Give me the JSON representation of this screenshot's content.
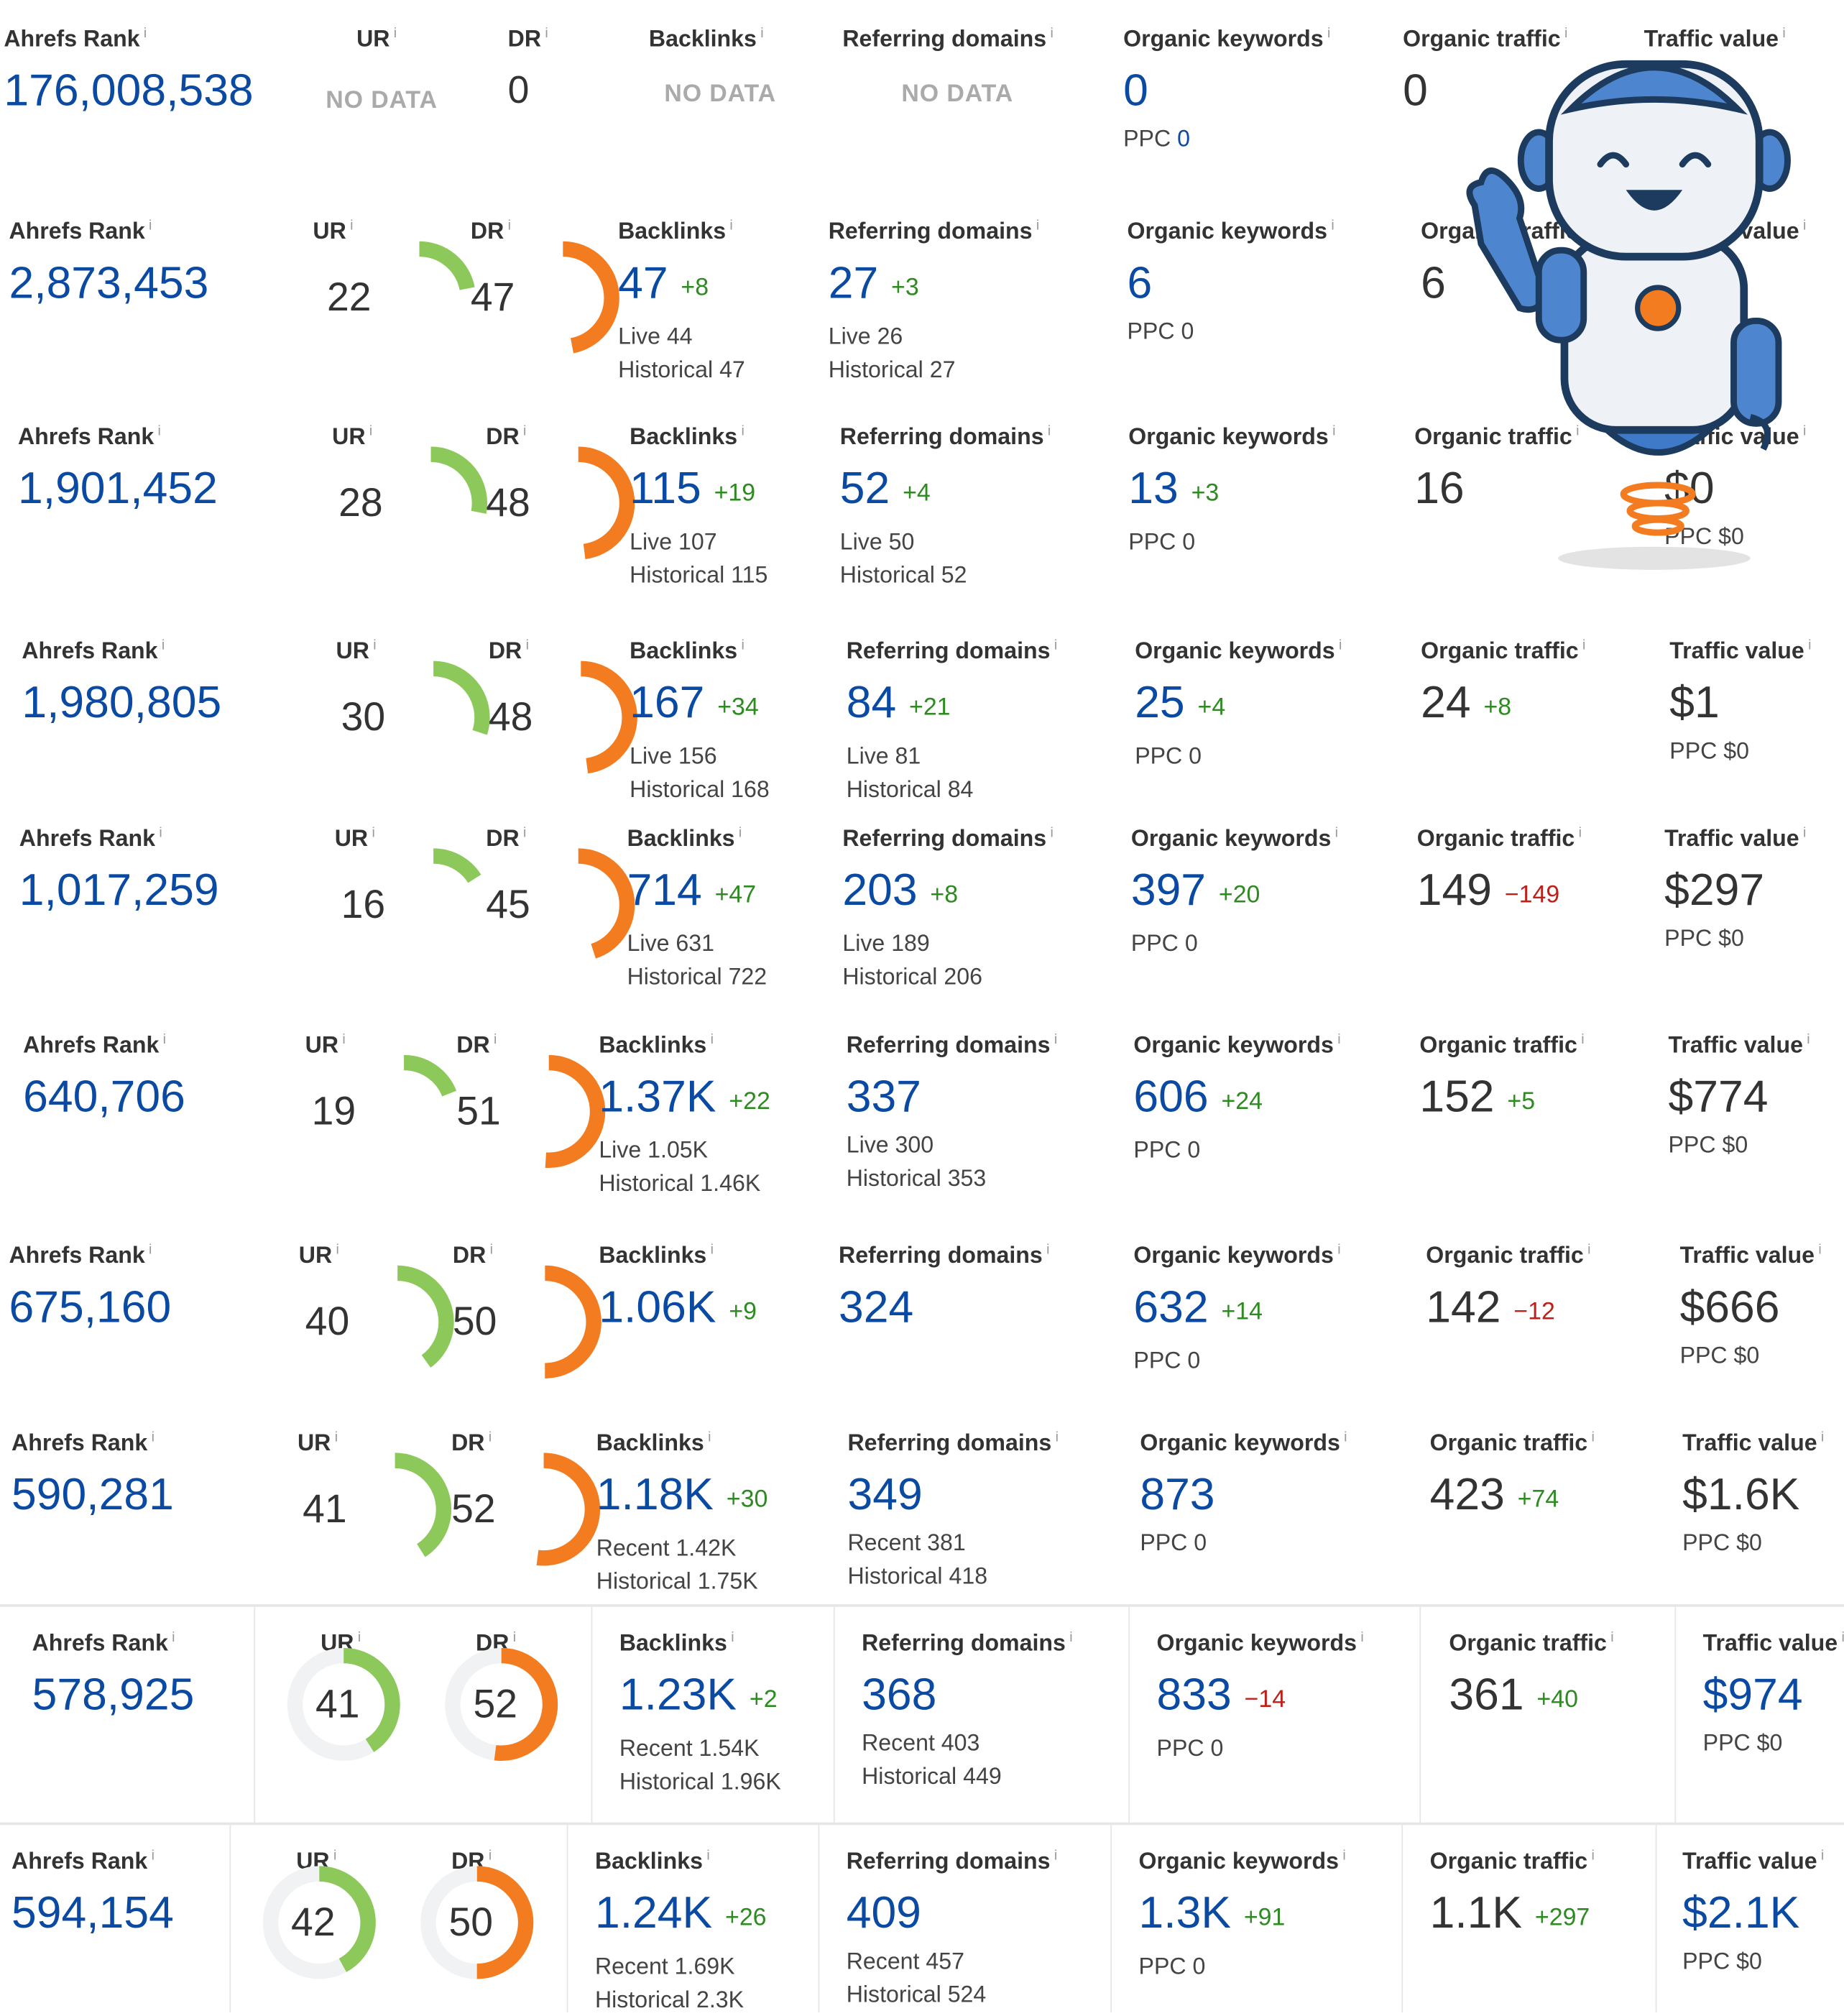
{
  "labels": {
    "ahrefs_rank": "Ahrefs Rank",
    "ur": "UR",
    "dr": "DR",
    "backlinks": "Backlinks",
    "referring_domains": "Referring domains",
    "organic_keywords": "Organic keywords",
    "organic_traffic": "Organic traffic",
    "traffic_value": "Traffic value",
    "info": "i",
    "no_data": "NO DATA",
    "live": "Live",
    "historical": "Historical",
    "recent": "Recent",
    "ppc": "PPC"
  },
  "colors": {
    "ur_ring": "#8dc85a",
    "dr_ring": "#f47c20",
    "ring_track": "#f1f2f3",
    "accent_blue": "#0b4aa2"
  },
  "rows": [
    {
      "rank": "176,008,538",
      "ur": "NO DATA",
      "dr": "0",
      "backlinks": "NO DATA",
      "refdomains": "NO DATA",
      "keywords": "0",
      "keywords_ppc": "0",
      "traffic": "0"
    },
    {
      "rank": "2,873,453",
      "ur": "22",
      "dr": "47",
      "backlinks": "47",
      "backlinks_delta": "+8",
      "backlinks_live": "44",
      "backlinks_hist": "47",
      "refdomains": "27",
      "refdomains_delta": "+3",
      "refdomains_live": "26",
      "refdomains_hist": "27",
      "keywords": "6",
      "keywords_ppc": "0",
      "traffic": "6"
    },
    {
      "rank": "1,901,452",
      "ur": "28",
      "dr": "48",
      "backlinks": "115",
      "backlinks_delta": "+19",
      "backlinks_live": "107",
      "backlinks_hist": "115",
      "refdomains": "52",
      "refdomains_delta": "+4",
      "refdomains_live": "50",
      "refdomains_hist": "52",
      "keywords": "13",
      "keywords_delta": "+3",
      "keywords_ppc": "0",
      "traffic": "16",
      "value": "$0",
      "value_ppc": "$0"
    },
    {
      "rank": "1,980,805",
      "ur": "30",
      "dr": "48",
      "backlinks": "167",
      "backlinks_delta": "+34",
      "backlinks_live": "156",
      "backlinks_hist": "168",
      "refdomains": "84",
      "refdomains_delta": "+21",
      "refdomains_live": "81",
      "refdomains_hist": "84",
      "keywords": "25",
      "keywords_delta": "+4",
      "keywords_ppc": "0",
      "traffic": "24",
      "traffic_delta": "+8",
      "value": "$1",
      "value_ppc": "$0"
    },
    {
      "rank": "1,017,259",
      "ur": "16",
      "dr": "45",
      "backlinks": "714",
      "backlinks_delta": "+47",
      "backlinks_live": "631",
      "backlinks_hist": "722",
      "refdomains": "203",
      "refdomains_delta": "+8",
      "refdomains_live": "189",
      "refdomains_hist": "206",
      "keywords": "397",
      "keywords_delta": "+20",
      "keywords_ppc": "0",
      "traffic": "149",
      "traffic_delta": "−149",
      "value": "$297",
      "value_ppc": "$0"
    },
    {
      "rank": "640,706",
      "ur": "19",
      "dr": "51",
      "backlinks": "1.37K",
      "backlinks_delta": "+22",
      "backlinks_live": "1.05K",
      "backlinks_hist": "1.46K",
      "refdomains": "337",
      "refdomains_live": "300",
      "refdomains_hist": "353",
      "keywords": "606",
      "keywords_delta": "+24",
      "keywords_ppc": "0",
      "traffic": "152",
      "traffic_delta": "+5",
      "value": "$774",
      "value_ppc": "$0"
    },
    {
      "rank": "675,160",
      "ur": "40",
      "dr": "50",
      "backlinks": "1.06K",
      "backlinks_delta": "+9",
      "refdomains": "324",
      "keywords": "632",
      "keywords_delta": "+14",
      "keywords_ppc": "0",
      "traffic": "142",
      "traffic_delta": "−12",
      "value": "$666",
      "value_ppc": "$0"
    },
    {
      "rank": "590,281",
      "ur": "41",
      "dr": "52",
      "backlinks": "1.18K",
      "backlinks_delta": "+30",
      "backlinks_recent": "1.42K",
      "backlinks_hist": "1.75K",
      "refdomains": "349",
      "refdomains_recent": "381",
      "refdomains_hist": "418",
      "keywords": "873",
      "keywords_ppc": "0",
      "traffic": "423",
      "traffic_delta": "+74",
      "value": "$1.6K",
      "value_ppc": "$0"
    },
    {
      "rank": "578,925",
      "ur": "41",
      "dr": "52",
      "backlinks": "1.23K",
      "backlinks_delta": "+2",
      "backlinks_recent": "1.54K",
      "backlinks_hist": "1.96K",
      "refdomains": "368",
      "refdomains_recent": "403",
      "refdomains_hist": "449",
      "keywords": "833",
      "keywords_delta": "−14",
      "keywords_ppc": "0",
      "traffic": "361",
      "traffic_delta": "+40",
      "value": "$974",
      "value_ppc": "$0"
    },
    {
      "rank": "594,154",
      "ur": "42",
      "dr": "50",
      "backlinks": "1.24K",
      "backlinks_delta": "+26",
      "backlinks_recent": "1.69K",
      "backlinks_hist": "2.3K",
      "refdomains": "409",
      "refdomains_recent": "457",
      "refdomains_hist": "524",
      "keywords": "1.3K",
      "keywords_delta": "+91",
      "keywords_ppc": "0",
      "traffic": "1.1K",
      "traffic_delta": "+297",
      "value": "$2.1K",
      "value_ppc": "$0"
    }
  ]
}
